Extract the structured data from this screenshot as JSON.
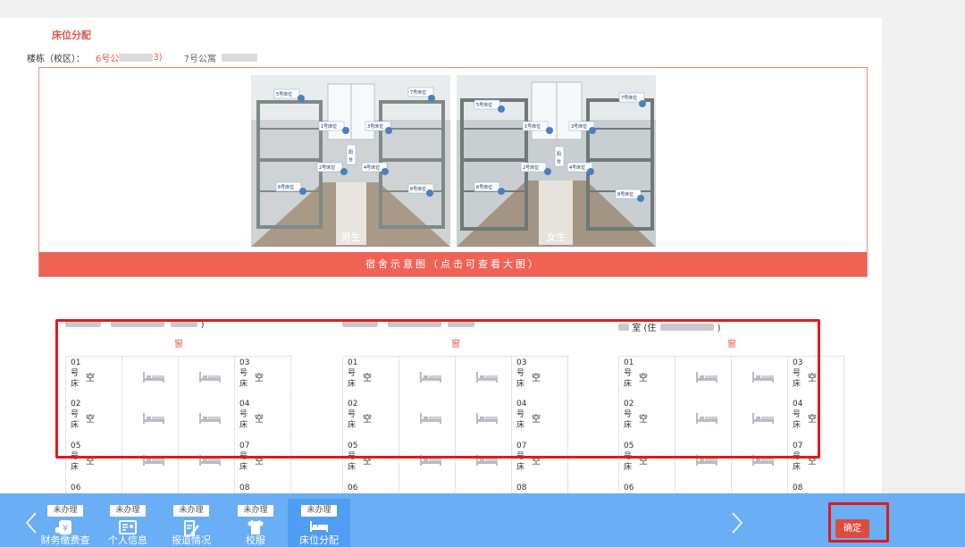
{
  "section": {
    "title": "床位分配"
  },
  "buildings": {
    "label": "楼栋（校区）：",
    "items": [
      {
        "name_prefix": "6号公",
        "name_suffix": "3)"
      },
      {
        "name_prefix": "7号公寓",
        "name_suffix": ""
      }
    ]
  },
  "schematic": {
    "bar_label": "宿舍示意图（点击可查看大图）",
    "photos": [
      {
        "caption": "男生",
        "bed_tags": [
          "5号床位",
          "7号床位",
          "1号床位",
          "3号床位",
          "阳台",
          "2号床位",
          "4号床位",
          "6号床位",
          "8号床位"
        ]
      },
      {
        "caption": "女生",
        "bed_tags": [
          "5号床位",
          "7号床位",
          "1号床位",
          "3号床位",
          "阳台",
          "2号床位",
          "4号床位",
          "6号床位",
          "8号床位"
        ]
      }
    ]
  },
  "rooms": [
    {
      "header_visible": ")",
      "window_label": "窗",
      "rows": [
        [
          "01号床",
          "空",
          "",
          "",
          "03号床",
          "空"
        ],
        [
          "02号床",
          "空",
          "",
          "",
          "04号床",
          "空"
        ],
        [
          "05号床",
          "空",
          "",
          "",
          "07号床",
          "空"
        ],
        [
          "06",
          "",
          "",
          "",
          "08",
          ""
        ]
      ]
    },
    {
      "header_visible": "",
      "window_label": "窗",
      "rows": [
        [
          "01号床",
          "空",
          "",
          "",
          "03号床",
          "空"
        ],
        [
          "02号床",
          "空",
          "",
          "",
          "04号床",
          "空"
        ],
        [
          "05号床",
          "空",
          "",
          "",
          "07号床",
          "空"
        ],
        [
          "06",
          "",
          "",
          "",
          "08",
          ""
        ]
      ]
    },
    {
      "header_visible_a": "室 (住",
      "header_visible_b": ")",
      "window_label": "窗",
      "rows": [
        [
          "01号床",
          "空",
          "",
          "",
          "03号床",
          "空"
        ],
        [
          "02号床",
          "空",
          "",
          "",
          "04号床",
          "空"
        ],
        [
          "05号床",
          "空",
          "",
          "",
          "07号床",
          "空"
        ],
        [
          "06",
          "",
          "",
          "",
          "08",
          ""
        ]
      ]
    }
  ],
  "bottom_nav": {
    "items": [
      {
        "label": "财务缴费查",
        "badge": "未办理",
        "icon": "yuan-wallet-icon"
      },
      {
        "label": "个人信息",
        "badge": "未办理",
        "icon": "id-card-icon"
      },
      {
        "label": "报道情况",
        "badge": "未办理",
        "icon": "edit-document-icon"
      },
      {
        "label": "校服",
        "badge": "未办理",
        "icon": "tshirt-icon"
      },
      {
        "label": "床位分配",
        "badge": "未办理",
        "icon": "bed-icon",
        "active": true
      }
    ],
    "confirm_label": "确定",
    "colors": {
      "bar": "#6aaef5",
      "active": "#4f9ef3",
      "confirm": "#dd4d3f"
    }
  },
  "colors": {
    "accent": "#e2574c",
    "schematic_bar": "#ef6355",
    "highlight": "#e01b1b"
  }
}
